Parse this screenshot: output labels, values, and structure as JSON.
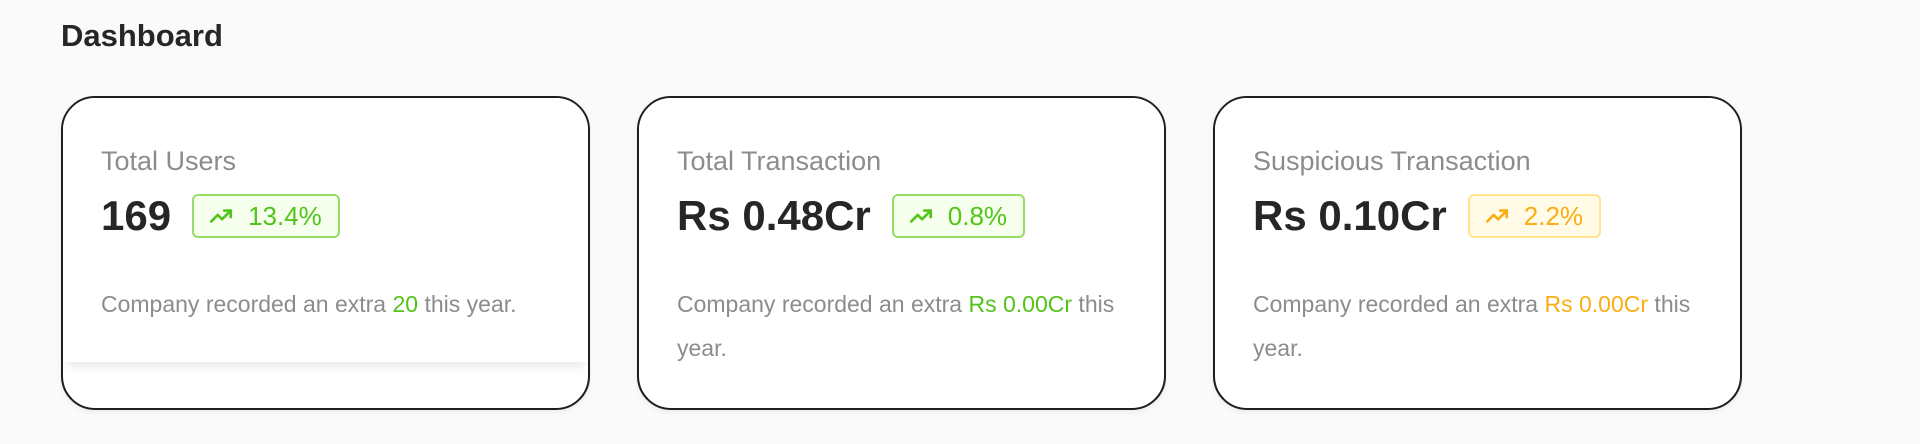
{
  "page": {
    "title": "Dashboard"
  },
  "colors": {
    "positive": "#52c41a",
    "warning": "#faad14"
  },
  "cards": [
    {
      "label": "Total Users",
      "value": "169",
      "trend_icon": "trending-up-icon",
      "badge": "13.4%",
      "desc_prefix": "Company recorded an extra ",
      "desc_highlight": "20",
      "desc_suffix": " this year."
    },
    {
      "label": "Total Transaction",
      "value": "Rs 0.48Cr",
      "trend_icon": "trending-up-icon",
      "badge": "0.8%",
      "desc_prefix": "Company recorded an extra ",
      "desc_highlight": "Rs 0.00Cr",
      "desc_suffix": " this year."
    },
    {
      "label": "Suspicious Transaction",
      "value": "Rs 0.10Cr",
      "trend_icon": "trending-up-icon",
      "badge": "2.2%",
      "desc_prefix": "Company recorded an extra ",
      "desc_highlight": "Rs 0.00Cr",
      "desc_suffix": " this year."
    }
  ]
}
